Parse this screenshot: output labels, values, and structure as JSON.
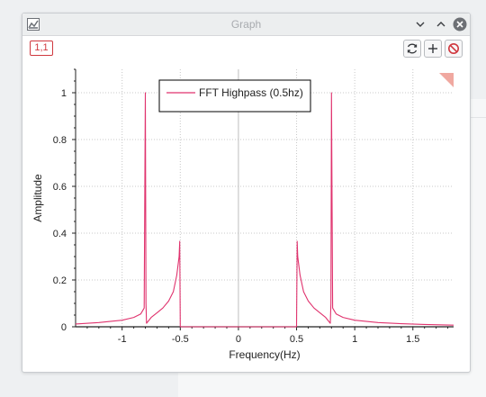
{
  "window": {
    "title": "Graph"
  },
  "toolbar": {
    "badge_label": "1,1",
    "buttons": [
      "refresh-icon",
      "add-icon",
      "clear-icon"
    ]
  },
  "colors": {
    "series": "#e0336e",
    "badge": "#d0383f",
    "clear": "#d0383f",
    "corner_marker": "#f0a8a0"
  },
  "chart_data": {
    "type": "line",
    "xlabel": "Frequency(Hz)",
    "ylabel": "Amplitude",
    "xlim": [
      -1.4,
      1.85
    ],
    "ylim": [
      0,
      1.1
    ],
    "xticks": [
      -1,
      -0.5,
      0,
      0.5,
      1,
      1.5
    ],
    "xtick_labels": [
      "-1",
      "-0.5",
      "0",
      "0.5",
      "1",
      "1.5"
    ],
    "yticks": [
      0,
      0.2,
      0.4,
      0.6,
      0.8,
      1
    ],
    "ytick_labels": [
      "0",
      "0.2",
      "0.4",
      "0.6",
      "0.8",
      "1"
    ],
    "grid": true,
    "legend_position": "top-center",
    "series": [
      {
        "name": "FFT Highpass (0.5hz)",
        "x": [
          -1.4,
          -1.2,
          -1.0,
          -0.9,
          -0.84,
          -0.81,
          -0.8,
          -0.795,
          -0.79,
          -0.75,
          -0.7,
          -0.65,
          -0.6,
          -0.56,
          -0.53,
          -0.51,
          -0.505,
          -0.5,
          -0.495,
          -0.48,
          -0.4,
          -0.2,
          0,
          0.2,
          0.4,
          0.48,
          0.495,
          0.5,
          0.505,
          0.51,
          0.53,
          0.56,
          0.6,
          0.65,
          0.7,
          0.75,
          0.79,
          0.795,
          0.8,
          0.81,
          0.84,
          0.9,
          1.0,
          1.2,
          1.4,
          1.6,
          1.85
        ],
        "y": [
          0.012,
          0.018,
          0.028,
          0.04,
          0.055,
          0.08,
          1.0,
          0.1,
          0.015,
          0.04,
          0.06,
          0.08,
          0.11,
          0.15,
          0.22,
          0.3,
          0.365,
          0.0,
          0.0,
          0.0,
          0.0,
          0.0,
          0.0,
          0.0,
          0.0,
          0.0,
          0.0,
          0.0,
          0.365,
          0.3,
          0.22,
          0.15,
          0.11,
          0.08,
          0.06,
          0.04,
          0.015,
          0.1,
          1.0,
          0.08,
          0.055,
          0.04,
          0.028,
          0.018,
          0.013,
          0.01,
          0.007
        ]
      }
    ]
  }
}
